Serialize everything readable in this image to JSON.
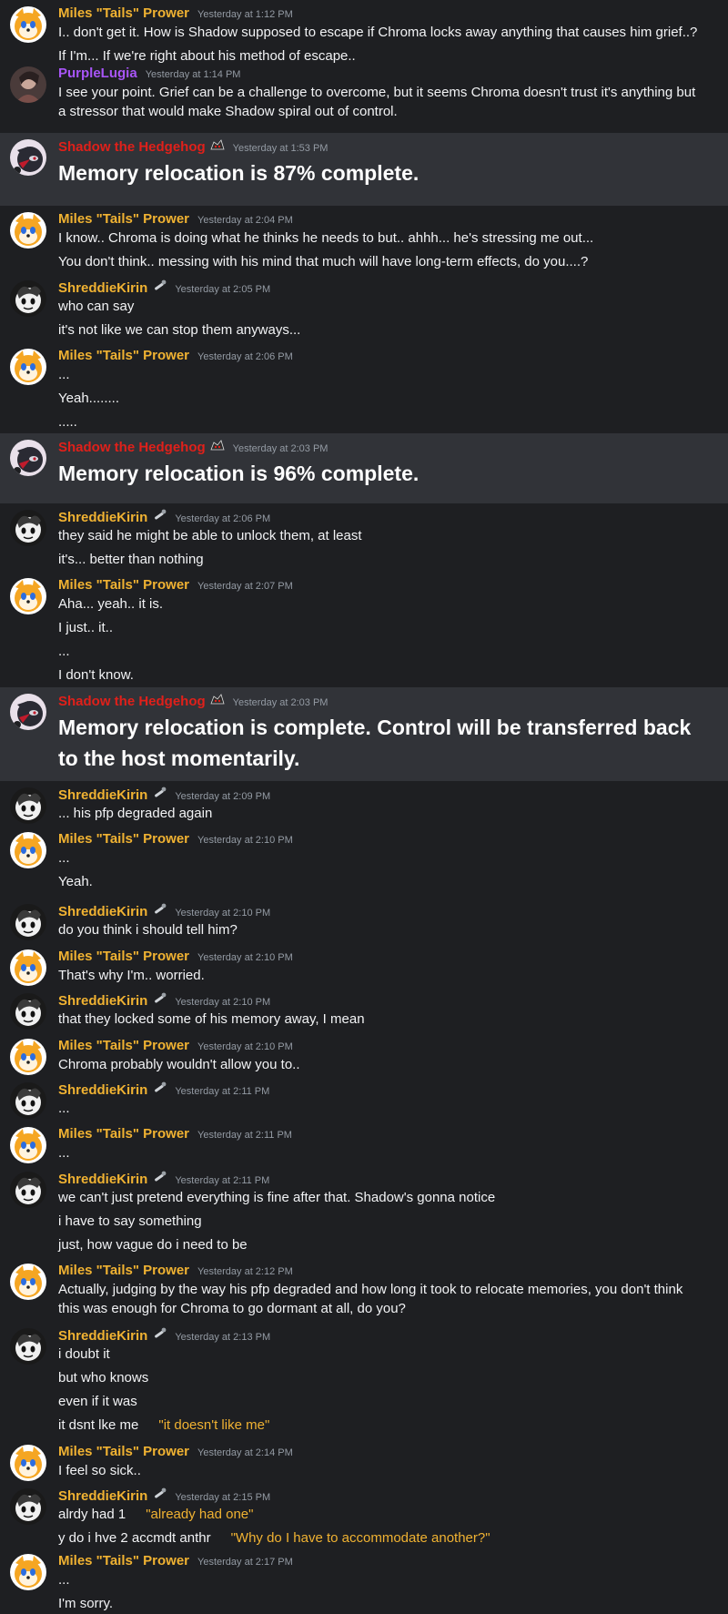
{
  "users": {
    "tails": {
      "name": "Miles \"Tails\" Prower",
      "color": "#f0b232"
    },
    "purple": {
      "name": "PurpleLugia",
      "color": "#a855f7"
    },
    "shadow": {
      "name": "Shadow the Hedgehog",
      "color": "#e0201a"
    },
    "shreddie": {
      "name": "ShreddieKirin",
      "color": "#f0b232"
    }
  },
  "messages": [
    {
      "user": "tails",
      "time": "Yesterday at 1:12 PM",
      "lines": [
        "I.. don't get it. How is Shadow supposed to escape if Chroma locks away anything that causes him grief..?",
        "If I'm... If we're right about his method of escape.."
      ]
    },
    {
      "user": "purple",
      "time": "Yesterday at 1:14 PM",
      "lines": [
        "I see your point. Grief can be a challenge to overcome, but it seems Chroma doesn't trust it's anything but a stressor that would make Shadow spiral out of control."
      ]
    },
    {
      "user": "shadow",
      "time": "Yesterday at 1:53 PM",
      "lines": [
        "Memory relocation is 87% complete."
      ]
    },
    {
      "user": "tails",
      "time": "Yesterday at 2:04 PM",
      "lines": [
        "I know.. Chroma is doing what he thinks he needs to but.. ahhh... he's stressing me out...",
        "You don't think.. messing with his mind that much will have long-term effects, do you....?"
      ]
    },
    {
      "user": "shreddie",
      "time": "Yesterday at 2:05 PM",
      "lines": [
        "who can say",
        "it's not like we can stop them anyways..."
      ]
    },
    {
      "user": "tails",
      "time": "Yesterday at 2:06 PM",
      "lines": [
        "...",
        "Yeah........",
        "....."
      ]
    },
    {
      "user": "shadow",
      "time": "Yesterday at 2:03 PM",
      "lines": [
        "Memory relocation is 96% complete."
      ]
    },
    {
      "user": "shreddie",
      "time": "Yesterday at 2:06 PM",
      "lines": [
        "they said he might be able to unlock them, at least",
        "it's... better than nothing"
      ]
    },
    {
      "user": "tails",
      "time": "Yesterday at 2:07 PM",
      "lines": [
        "Aha... yeah.. it is.",
        "I just.. it..",
        "...",
        "I don't know."
      ]
    },
    {
      "user": "shadow",
      "time": "Yesterday at 2:03 PM",
      "lines": [
        "Memory relocation is complete. Control will be transferred back to the host momentarily."
      ]
    },
    {
      "user": "shreddie",
      "time": "Yesterday at 2:09 PM",
      "lines": [
        "... his pfp degraded again"
      ]
    },
    {
      "user": "tails",
      "time": "Yesterday at 2:10 PM",
      "lines": [
        "...",
        "Yeah."
      ]
    },
    {
      "user": "shreddie",
      "time": "Yesterday at 2:10 PM",
      "lines": [
        "do you think i should tell him?"
      ]
    },
    {
      "user": "tails",
      "time": "Yesterday at 2:10 PM",
      "lines": [
        "That's why I'm.. worried."
      ]
    },
    {
      "user": "shreddie",
      "time": "Yesterday at 2:10 PM",
      "lines": [
        "that they locked some of his memory away, I mean"
      ]
    },
    {
      "user": "tails",
      "time": "Yesterday at 2:10 PM",
      "lines": [
        "Chroma probably wouldn't allow you to.."
      ]
    },
    {
      "user": "shreddie",
      "time": "Yesterday at 2:11 PM",
      "lines": [
        "..."
      ]
    },
    {
      "user": "tails",
      "time": "Yesterday at 2:11 PM",
      "lines": [
        "..."
      ]
    },
    {
      "user": "shreddie",
      "time": "Yesterday at 2:11 PM",
      "lines": [
        "we can't just pretend everything is fine after that. Shadow's gonna notice",
        "i have to say something",
        "just, how vague do i need to be"
      ]
    },
    {
      "user": "tails",
      "time": "Yesterday at 2:12 PM",
      "lines": [
        "Actually, judging by the way his pfp degraded and how long it took to relocate memories, you don't think this was enough for Chroma to go dormant at all, do you?"
      ]
    },
    {
      "user": "shreddie",
      "time": "Yesterday at 2:13 PM",
      "lines": [
        "i doubt it",
        "but who knows",
        "even if it was",
        "it dsnt lke me"
      ],
      "notes": {
        "3": "\"it doesn't like me\""
      }
    },
    {
      "user": "tails",
      "time": "Yesterday at 2:14 PM",
      "lines": [
        "I feel so sick.."
      ]
    },
    {
      "user": "shreddie",
      "time": "Yesterday at 2:15 PM",
      "lines": [
        "alrdy had 1",
        "y do i hve 2 accmdt anthr"
      ],
      "notes": {
        "0": "\"already had one\"",
        "1": "\"Why do I have to accommodate another?\""
      }
    },
    {
      "user": "tails",
      "time": "Yesterday at 2:17 PM",
      "lines": [
        "...",
        "I'm sorry."
      ]
    }
  ]
}
